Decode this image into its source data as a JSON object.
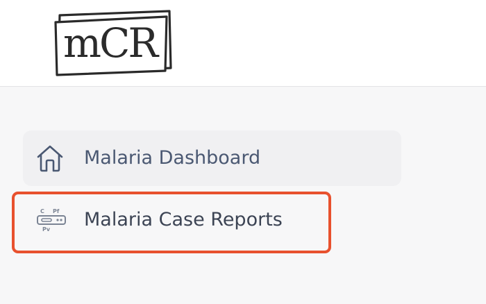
{
  "header": {
    "logo_text": "mCR",
    "logo_icon": "mcr-logo"
  },
  "sidebar": {
    "items": [
      {
        "label": "Malaria Dashboard",
        "icon": "home-icon",
        "active": false
      },
      {
        "label": "Malaria Case Reports",
        "icon": "rapid-test-icon",
        "highlighted": true,
        "test_markers": {
          "c": "C",
          "pf": "Pf",
          "pv": "Pv"
        }
      }
    ]
  },
  "colors": {
    "highlight_border": "#e8512e",
    "dashboard_text": "#4a5872",
    "reports_text": "#3c4454",
    "active_bg": "#f0f0f2",
    "page_bg": "#f7f7f8",
    "header_bg": "#ffffff"
  }
}
